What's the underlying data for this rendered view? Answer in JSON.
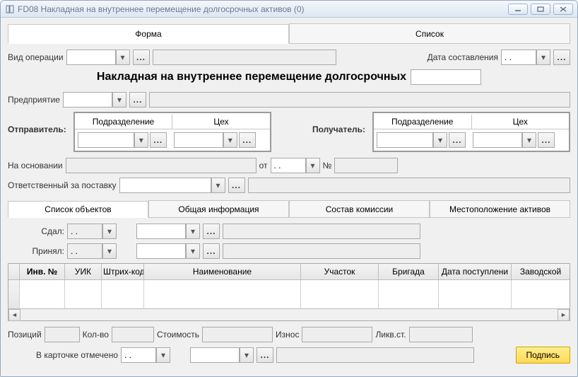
{
  "window": {
    "title": "FD08 Накладная на внутреннее перемещение долгосрочных активов (0)"
  },
  "tabs": {
    "form": "Форма",
    "list": "Список"
  },
  "toprow": {
    "operation_label": "Вид операции",
    "date_label": "Дата составления",
    "date_value": " .  ."
  },
  "heading": "Накладная на внутреннее перемещение долгосрочных",
  "enterprise_label": "Предприятие",
  "sender": {
    "label": "Отправитель:",
    "col1": "Подразделение",
    "col2": "Цех"
  },
  "receiver": {
    "label": "Получатель:",
    "col1": "Подразделение",
    "col2": "Цех"
  },
  "basis": {
    "label": "На основании",
    "from": "от",
    "from_value": " .  .",
    "num": "№"
  },
  "responsible_label": "Ответственный за поставку",
  "subtabs": {
    "t1": "Список объектов",
    "t2": "Общая информация",
    "t3": "Состав комиссии",
    "t4": "Местоположение активов"
  },
  "gave": {
    "label": "Сдал:",
    "value": " .  ."
  },
  "took": {
    "label": "Принял:",
    "value": " .  ."
  },
  "grid_cols": [
    "Инв. №",
    "УИК",
    "Штрих-код",
    "Наименование",
    "Участок",
    "Бригада",
    "Дата поступлени",
    "Заводской"
  ],
  "totals": {
    "positions": "Позиций",
    "qty": "Кол-во",
    "cost": "Стоимость",
    "wear": "Износ",
    "salvage": "Ликв.ст."
  },
  "card_marked": {
    "label": "В карточке отмечено",
    "value": " .  ."
  },
  "submit": "Подпись"
}
